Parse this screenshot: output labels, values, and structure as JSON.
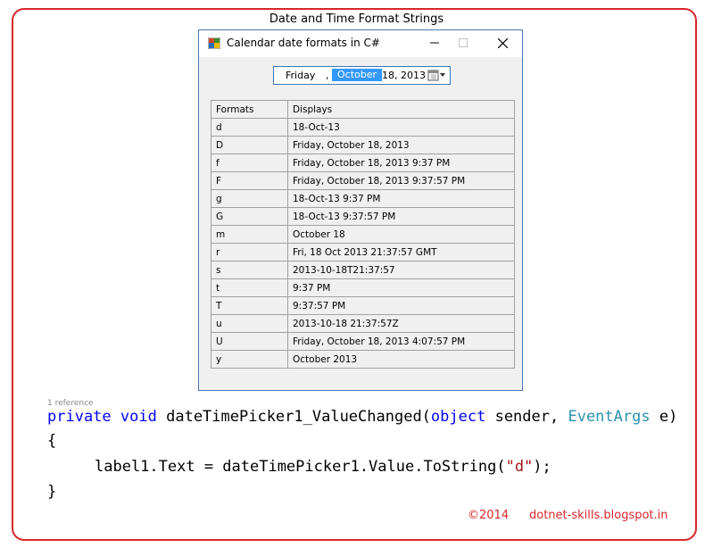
{
  "page_title": "Date and Time Format Strings",
  "window": {
    "title": "Calendar date formats in C#",
    "minimize_glyph": "—",
    "maximize_glyph": "☐",
    "close_glyph": "✕"
  },
  "datepicker": {
    "day": "Friday",
    "comma": ",",
    "month": "October",
    "rest": "18, 2013",
    "selected_color": "#3399ff"
  },
  "table": {
    "headers": [
      "Formats",
      "Displays"
    ],
    "rows": [
      [
        "d",
        "18-Oct-13"
      ],
      [
        "D",
        "Friday, October 18, 2013"
      ],
      [
        "f",
        "Friday, October 18, 2013 9:37 PM"
      ],
      [
        "F",
        "Friday, October 18, 2013 9:37:57 PM"
      ],
      [
        "g",
        "18-Oct-13 9:37 PM"
      ],
      [
        "G",
        "18-Oct-13 9:37:57 PM"
      ],
      [
        "m",
        "October 18"
      ],
      [
        "r",
        "Fri, 18 Oct 2013 21:37:57 GMT"
      ],
      [
        "s",
        "2013-10-18T21:37:57"
      ],
      [
        "t",
        "9:37 PM"
      ],
      [
        "T",
        "9:37:57 PM"
      ],
      [
        "u",
        "2013-10-18 21:37:57Z"
      ],
      [
        "U",
        "Friday, October 18, 2013 4:07:57 PM"
      ],
      [
        "y",
        "October 2013"
      ]
    ]
  },
  "code": {
    "reference_hint": "1 reference",
    "line1": {
      "kw1": "private",
      "kw2": "void",
      "name": "dateTimePicker1_ValueChanged(",
      "kw3": "object",
      "p1": " sender, ",
      "type": "EventArgs",
      "p2": " e)"
    },
    "line2": "{",
    "line3": {
      "pre": "label1.Text = dateTimePicker1.Value.ToString(",
      "str": "\"d\"",
      "post": ");"
    },
    "line4": "}"
  },
  "footer": {
    "copyright": "©2014",
    "site": "dotnet-skills.blogspot.in"
  },
  "colors": {
    "frame": "#d9262a",
    "keyword": "#0000ff",
    "type": "#2b91af",
    "string": "#a31515"
  }
}
